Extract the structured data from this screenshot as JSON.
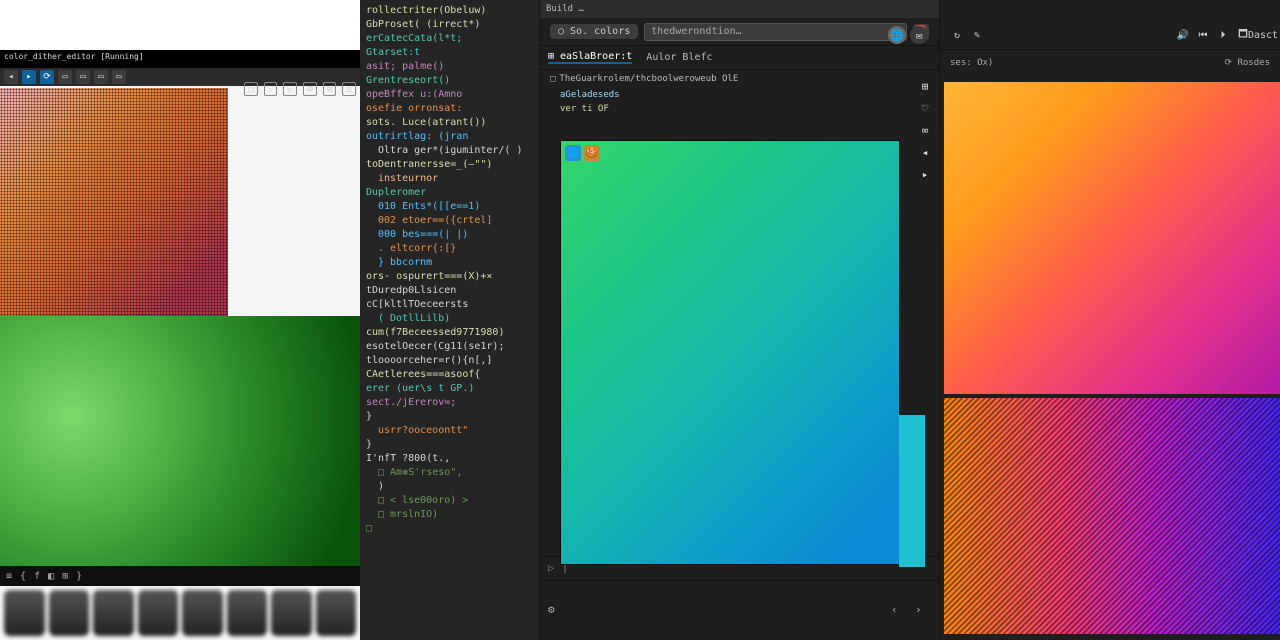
{
  "left_window": {
    "toolbar_title": "color_dither_editor [Running]",
    "toolbar_icons": [
      "back",
      "fwd",
      "reload",
      "home",
      "tab1",
      "tab2",
      "close"
    ],
    "side_icons": [
      "□",
      "⇧",
      "▷",
      "⧉",
      "⊞",
      "⊡"
    ],
    "taskbar": [
      "≡",
      "{",
      "f",
      "◧",
      "⊞",
      "}"
    ]
  },
  "editor": {
    "lines": [
      {
        "t": "rollectriter(Obeluw)",
        "c": "fn"
      },
      {
        "t": "GbProset( (irrect*)",
        "c": "fn"
      },
      {
        "t": "erCatecCata(l*t;",
        "c": "ty"
      },
      {
        "t": "Gtarset:t",
        "c": "ty"
      },
      {
        "t": "asit; palme()",
        "c": "kw"
      },
      {
        "t": "Grentreseort()",
        "c": "ty"
      },
      {
        "t": "opeBffex u:(Amno",
        "c": "kw"
      },
      {
        "t": "osefie orronsat:",
        "c": "lref"
      },
      {
        "t": "sots. Luce(atrant())",
        "c": "fn"
      },
      {
        "t": "outrirtlag: (jran",
        "c": "pa"
      },
      {
        "t": "  Oltra ger*(iguminter/( )",
        "c": "op",
        "i": 1
      },
      {
        "t": "",
        "c": "op"
      },
      {
        "t": "toDentranersse=_(—\"\")",
        "c": "fn"
      },
      {
        "t": "  insteurnor",
        "c": "hl",
        "i": 1
      },
      {
        "t": "Dupleromer",
        "c": "ty"
      },
      {
        "t": "  010   Ents*([[e==1)",
        "c": "pa",
        "i": 1
      },
      {
        "t": "  002   etoer==({crtel]",
        "c": "lref",
        "i": 1
      },
      {
        "t": "  000   bes===(| |)",
        "c": "pa",
        "i": 1
      },
      {
        "t": "  .     eltcorr{:[}",
        "c": "lref",
        "i": 1
      },
      {
        "t": "  }     bbcornm",
        "c": "pa",
        "i": 1
      },
      {
        "t": "ors-   ospurert===(X)+×",
        "c": "fn"
      },
      {
        "t": "tDuredp0Llsicen",
        "c": "op"
      },
      {
        "t": "cC[kltlTOeceersts",
        "c": "op"
      },
      {
        "t": "(   DotllLilb)",
        "c": "ty",
        "i": 1
      },
      {
        "t": "cum(f7Beceessed9771980)",
        "c": "fn"
      },
      {
        "t": "esotelOecer(Cg11(se1r);",
        "c": "op"
      },
      {
        "t": "tloooorceher=r(){n[,]",
        "c": "op"
      },
      {
        "t": "CAetlerees===asoof{",
        "c": "fn"
      },
      {
        "t": "",
        "c": "op"
      },
      {
        "t": "erer (uer\\s t GP.)",
        "c": "ty"
      },
      {
        "t": "sect./jErerov=;",
        "c": "kw"
      },
      {
        "t": "}",
        "c": "op"
      },
      {
        "t": "   usrr?ooceoontt\"",
        "c": "lref",
        "i": 1
      },
      {
        "t": "}",
        "c": "op"
      },
      {
        "t": "I'nfT ?800(t.,",
        "c": "op"
      },
      {
        "t": "",
        "c": "op"
      },
      {
        "t": "□   Am⨳S'rseso\",",
        "c": "cm",
        "i": 1
      },
      {
        "t": "   )",
        "c": "op",
        "i": 1
      },
      {
        "t": "□   < lse00oro) >",
        "c": "cm",
        "i": 1
      },
      {
        "t": "",
        "c": "op"
      },
      {
        "t": "□   mrslnIO)",
        "c": "cm",
        "i": 1
      },
      {
        "t": "□",
        "c": "cm"
      }
    ]
  },
  "ide": {
    "menu": "Build …",
    "search_chip": "○ So. colors",
    "search_placeholder": "thedwerondtion…",
    "search_action_icon": "📅",
    "tabs": [
      {
        "label": "⊞ eaSlaBroer:t",
        "active": true
      },
      {
        "label": "Aulor Blefc",
        "active": false
      }
    ],
    "path_icon": "□",
    "path": "TheGuarkrolem/thcboolweroweub  OlE",
    "sub1": "aGeladeseds",
    "sub2": "ver ti  OF",
    "prompt_marker": "▷",
    "prompt_cursor": "|",
    "below_icon": "⚙",
    "below_arrows": [
      "‹",
      "›"
    ],
    "right_tools": [
      "⊞",
      "♡",
      "∞"
    ],
    "preview_badges": [
      "🌐",
      "🍪"
    ],
    "nav_arrows": [
      "◂",
      "▸"
    ]
  },
  "top_badges": [
    "🌐",
    "✉"
  ],
  "right_window": {
    "left_icons": [
      "↻",
      "✎"
    ],
    "right_group": [
      "🔊",
      "⏮",
      "⏵",
      "🗖"
    ],
    "right_label": "Dasct",
    "sub_left": "ses: Ox)",
    "sub_right": "⟳  Rosdes"
  }
}
